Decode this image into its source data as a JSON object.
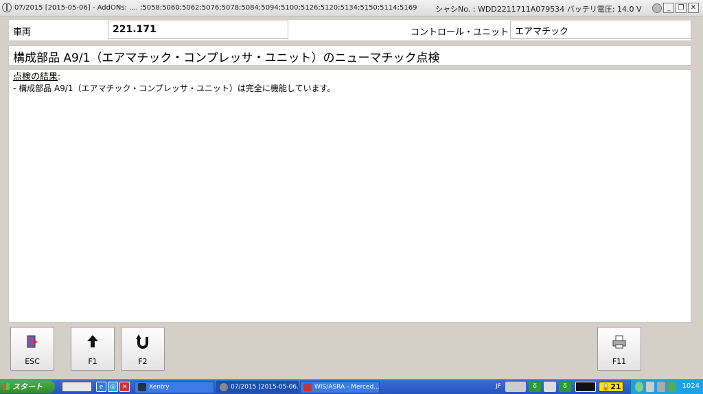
{
  "window": {
    "title_left": "07/2015 [2015-05-06] - AddONs:  .... ;5058;5060;5062;5076;5078;5084;5094;5100;5126;5120;5134;5150;5114;5169",
    "title_right": "シャシNo. : WDD2211711A079534   バッテリ電圧: 14.0 V",
    "minimize_icon": "minimize-icon",
    "restore_icon": "restore-icon",
    "close_icon": "close-icon"
  },
  "vehicle": {
    "label": "車両",
    "value": "221.171",
    "control_unit_label": "コントロール・ユニット",
    "control_unit_value": "エアマチック"
  },
  "page": {
    "title": "構成部品 A9/1（エアマチック・コンプレッサ・ユニット）のニューマチック点検"
  },
  "result": {
    "heading": "点検の結果",
    "heading_colon": ":",
    "line": "- 構成部品 A9/1（エアマチック・コンプレッサ・ユニット）は完全に機能しています。"
  },
  "function_buttons": [
    {
      "label": "ESC",
      "icon": "exit-door-icon"
    },
    {
      "label": "F1",
      "icon": "arrow-up-icon"
    },
    {
      "label": "F2",
      "icon": "u-turn-icon"
    },
    {
      "label": "F11",
      "icon": "printer-icon"
    }
  ],
  "taskbar": {
    "start_label": "スタート",
    "tasks": [
      {
        "label": "Xentry",
        "active": false
      },
      {
        "label": "07/2015 [2015-05-06...",
        "active": true
      },
      {
        "label": "WIS/ASRA - Merced...",
        "active": false
      }
    ],
    "jf_label": "JF",
    "counter": "21",
    "clock": "1024"
  },
  "colors": {
    "accent_blue": "#2354c0",
    "tray_blue": "#1ea0e8",
    "start_green": "#2f8a2f",
    "counter_yellow": "#ffe400"
  }
}
